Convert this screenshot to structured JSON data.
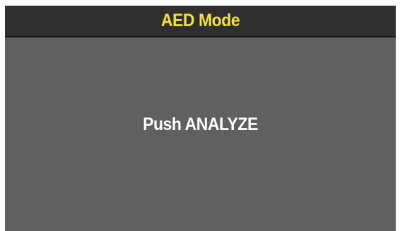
{
  "header": {
    "title": "AED Mode"
  },
  "main": {
    "prompt": "Push ANALYZE"
  },
  "colors": {
    "title_text": "#f2e23a",
    "header_background": "#2f2f2f",
    "screen_background": "#606060",
    "prompt_text": "#ffffff"
  }
}
